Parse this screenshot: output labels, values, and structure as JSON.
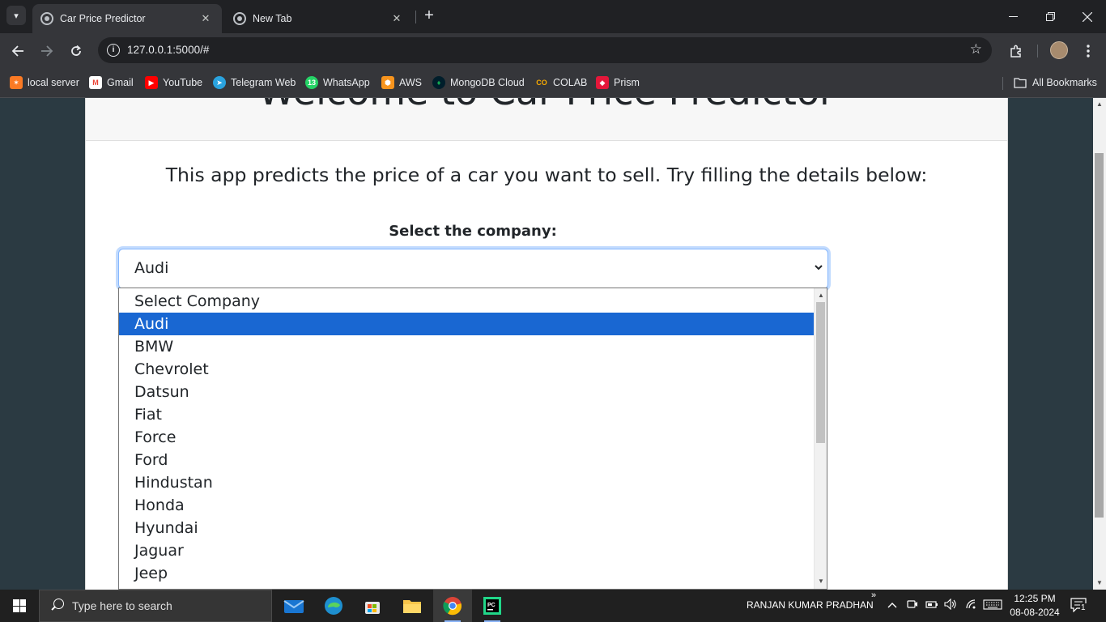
{
  "browser": {
    "tabs": [
      {
        "title": "Car Price Predictor",
        "close": "✕"
      },
      {
        "title": "New Tab",
        "close": "✕"
      }
    ],
    "new_tab": "+",
    "url": "127.0.0.1:5000/#",
    "bookmarks": [
      {
        "label": "local server",
        "icon": "xampp-icon",
        "color": "#fb7a24"
      },
      {
        "label": "Gmail",
        "icon": "gmail-icon",
        "color": "#ea4335"
      },
      {
        "label": "YouTube",
        "icon": "youtube-icon",
        "color": "#ff0000"
      },
      {
        "label": "Telegram Web",
        "icon": "telegram-icon",
        "color": "#2aa3df"
      },
      {
        "label": "WhatsApp",
        "icon": "whatsapp-icon",
        "color": "#25d366",
        "badge": "13"
      },
      {
        "label": "AWS",
        "icon": "aws-icon",
        "color": "#f7941d"
      },
      {
        "label": "MongoDB Cloud",
        "icon": "mongodb-icon",
        "color": "#13aa52"
      },
      {
        "label": "COLAB",
        "icon": "colab-icon",
        "color": "#f9ab00",
        "glyph": "CO"
      },
      {
        "label": "Prism",
        "icon": "prism-icon",
        "color": "#e4173a"
      }
    ],
    "all_bookmarks": "All Bookmarks"
  },
  "page": {
    "welcome": "Welcome to Car Price Predictor",
    "intro": "This app predicts the price of a car you want to sell. Try filling the details below:",
    "select_label": "Select the company:",
    "selected_company": "Audi",
    "options": [
      "Select Company",
      "Audi",
      "BMW",
      "Chevrolet",
      "Datsun",
      "Fiat",
      "Force",
      "Ford",
      "Hindustan",
      "Honda",
      "Hyundai",
      "Jaguar",
      "Jeep"
    ],
    "selected_index": 1
  },
  "taskbar": {
    "search_placeholder": "Type here to search",
    "user": "RANJAN KUMAR PRADHAN",
    "time": "12:25 PM",
    "date": "08-08-2024",
    "notification_count": "1"
  },
  "colors": {
    "selected_option": "#1967d2",
    "focus_ring": "#86b7fe",
    "page_background": "#2b3a42"
  }
}
